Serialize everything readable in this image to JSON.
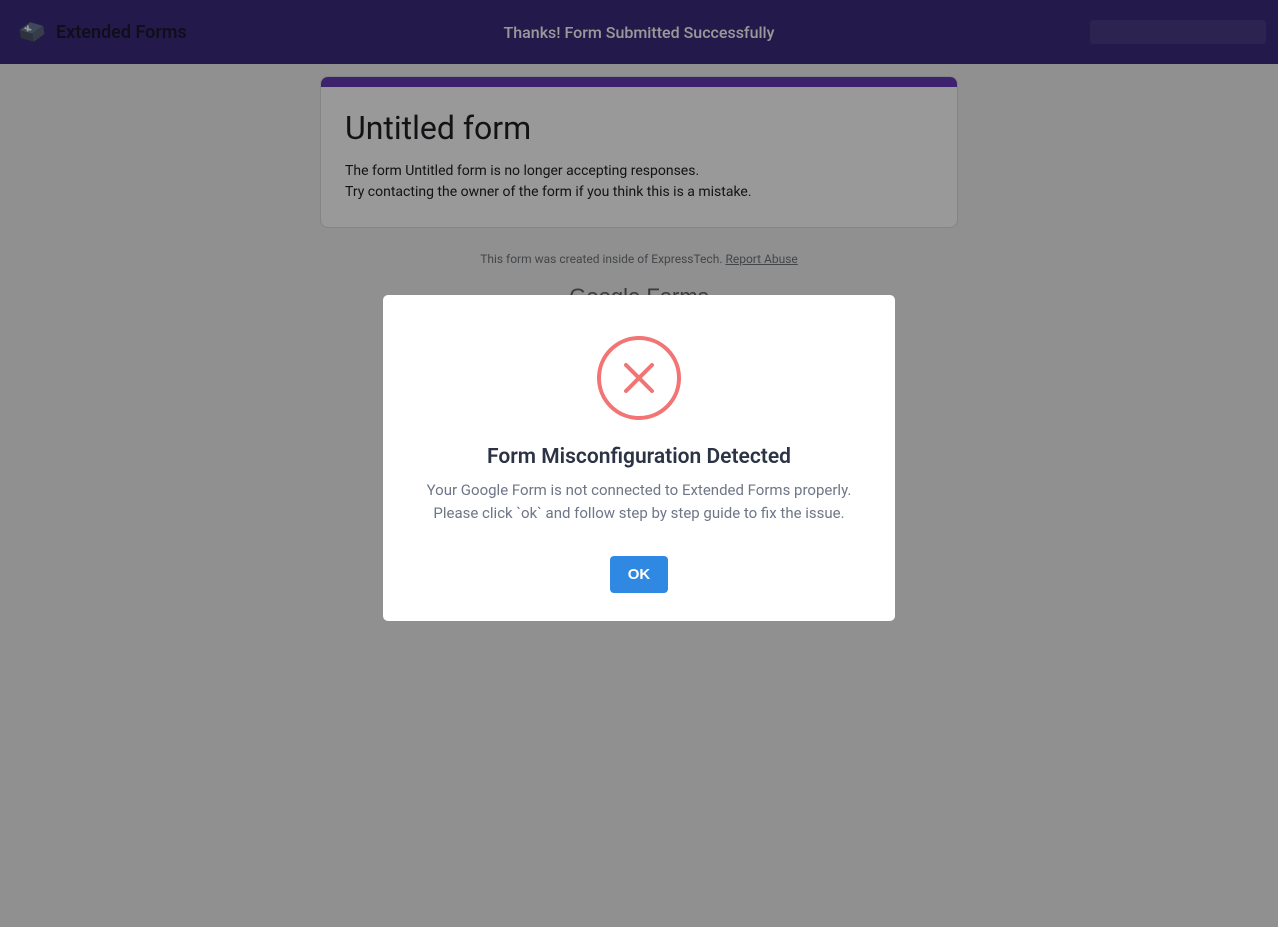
{
  "header": {
    "brand": "Extended Forms",
    "title": "Thanks! Form Submitted Successfully"
  },
  "form": {
    "title": "Untitled form",
    "message_line1": "The form Untitled form is no longer accepting responses.",
    "message_line2": "Try contacting the owner of the form if you think this is a mistake.",
    "footer_prefix": "This form was created inside of ExpressTech. ",
    "report_abuse": "Report Abuse",
    "brand_bold": "Google",
    "brand_light": " Forms"
  },
  "modal": {
    "title": "Form Misconfiguration Detected",
    "text": "Your Google Form is not connected to Extended Forms properly. Please click `ok` and follow step by step guide to fix the issue.",
    "ok_label": "OK"
  }
}
